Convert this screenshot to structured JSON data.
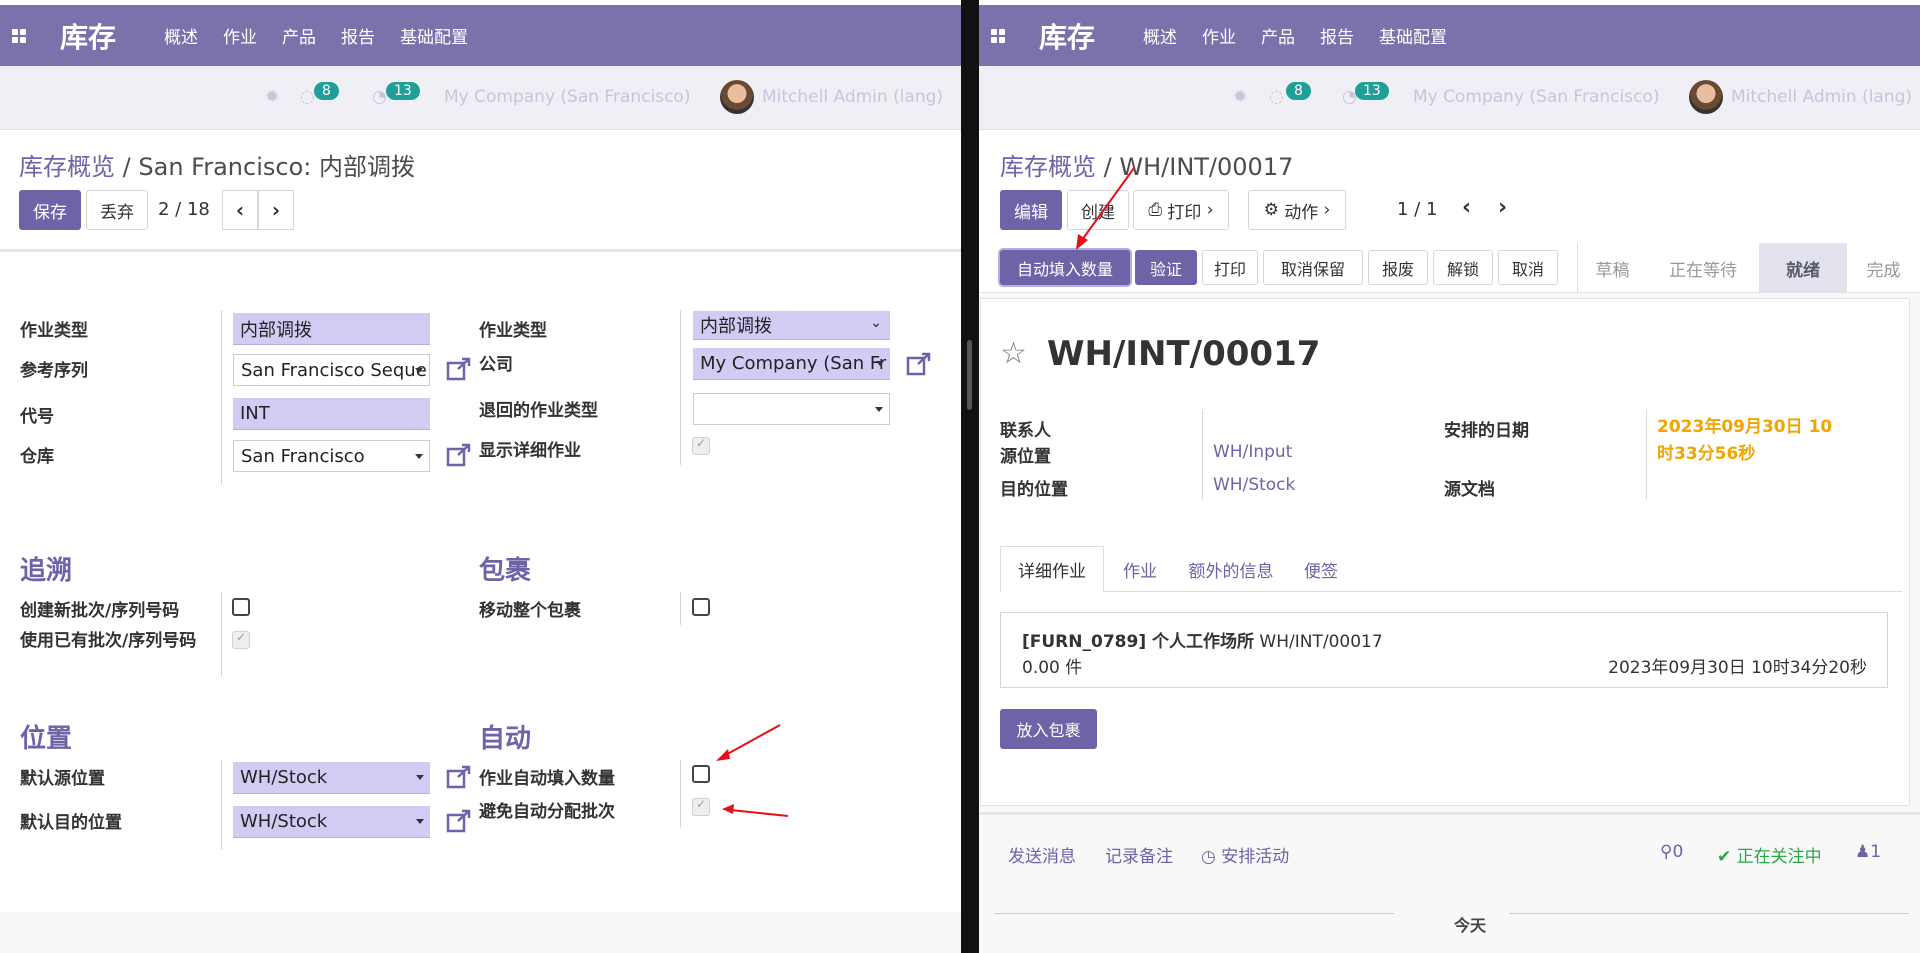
{
  "left": {
    "brand": "库存",
    "menu": [
      "概述",
      "作业",
      "产品",
      "报告",
      "基础配置"
    ],
    "systray": {
      "activity_count": "8",
      "message_count": "13",
      "company": "My Company (San Francisco)",
      "user": "Mitchell Admin (lang)"
    },
    "breadcrumb": {
      "parent": "库存概览",
      "sep": "/",
      "current": "San Francisco: 内部调拨"
    },
    "buttons": {
      "save": "保存",
      "discard": "丢弃"
    },
    "pager": "2 / 18",
    "form": {
      "labels": {
        "op_type": "作业类型",
        "sequence": "参考序列",
        "code": "代号",
        "warehouse": "仓库",
        "op_type2": "作业类型",
        "company": "公司",
        "return_type": "退回的作业类型",
        "show_detailed": "显示详细作业",
        "create_lots": "创建新批次/序列号码",
        "use_existing_lots": "使用已有批次/序列号码",
        "move_entire_packs": "移动整个包裹",
        "default_src": "默认源位置",
        "default_dest": "默认目的位置",
        "auto_fill_qty": "作业自动填入数量",
        "avoid_auto_assign": "避免自动分配批次"
      },
      "values": {
        "op_type": "内部调拨",
        "sequence": "San Francisco Seque",
        "code": "INT",
        "warehouse": "San Francisco",
        "op_type2": "内部调拨",
        "company": "My Company (San Fr",
        "return_type": "",
        "default_src": "WH/Stock",
        "default_dest": "WH/Stock"
      },
      "sections": {
        "traceability": "追溯",
        "packages": "包裹",
        "locations": "位置",
        "automation": "自动"
      }
    }
  },
  "right": {
    "brand": "库存",
    "menu": [
      "概述",
      "作业",
      "产品",
      "报告",
      "基础配置"
    ],
    "systray": {
      "activity_count": "8",
      "message_count": "13",
      "company": "My Company (San Francisco)",
      "user": "Mitchell Admin (lang)"
    },
    "breadcrumb": {
      "parent": "库存概览",
      "sep": "/",
      "current": "WH/INT/00017"
    },
    "buttons": {
      "edit": "编辑",
      "create": "创建",
      "print": "打印",
      "action": "动作"
    },
    "pager": "1 / 1",
    "header_buttons": [
      "自动填入数量",
      "验证",
      "打印",
      "取消保留",
      "报废",
      "解锁",
      "取消"
    ],
    "status": [
      "草稿",
      "正在等待",
      "就绪",
      "完成"
    ],
    "record": {
      "title": "WH/INT/00017",
      "labels": {
        "partner": "联系人",
        "src": "源位置",
        "dest": "目的位置",
        "scheduled": "安排的日期",
        "origin": "源文档"
      },
      "values": {
        "src": "WH/Input",
        "dest": "WH/Stock",
        "scheduled": "2023年09月30日 10时33分56秒"
      },
      "tabs": [
        "详细作业",
        "作业",
        "额外的信息",
        "便签"
      ],
      "line": {
        "product": "[FURN_0789] 个人工作场所",
        "ref": "WH/INT/00017",
        "qty": "0.00 件",
        "date": "2023年09月30日 10时34分20秒"
      },
      "put_in_pack": "放入包裹"
    },
    "chatter": {
      "send": "发送消息",
      "log": "记录备注",
      "schedule": "安排活动",
      "attachments": "0",
      "following": "正在关注中",
      "followers": "1",
      "today": "今天"
    }
  },
  "colors": {
    "brand": "#7a73ab",
    "primary": "#6c64a6",
    "required": "#d2ccf5",
    "badge": "#1f9f97",
    "date": "#f0a500",
    "arrow": "#e5101a"
  }
}
